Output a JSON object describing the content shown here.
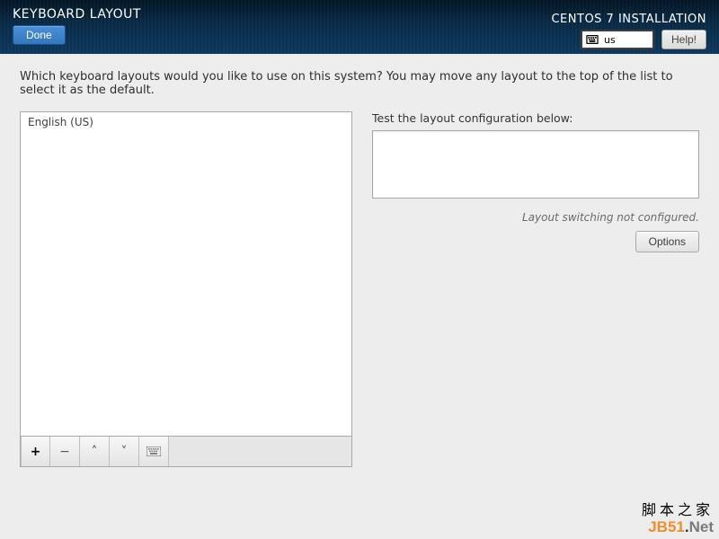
{
  "header": {
    "title": "KEYBOARD LAYOUT",
    "done_label": "Done",
    "install_title": "CENTOS 7 INSTALLATION",
    "lang_code": "us",
    "help_label": "Help!"
  },
  "prompt": "Which keyboard layouts would you like to use on this system?  You may move any layout to the top of the list to select it as the default.",
  "layouts": {
    "items": [
      "English (US)"
    ]
  },
  "toolbar": {
    "add": "+",
    "remove": "−",
    "up": "˄",
    "down": "˅"
  },
  "test": {
    "label": "Test the layout configuration below:",
    "value": ""
  },
  "switch_msg": "Layout switching not configured.",
  "options_label": "Options",
  "watermark": {
    "line1": "脚本之家",
    "line2_a": "JB51",
    "line2_b": ".",
    "line2_c": "Net"
  }
}
